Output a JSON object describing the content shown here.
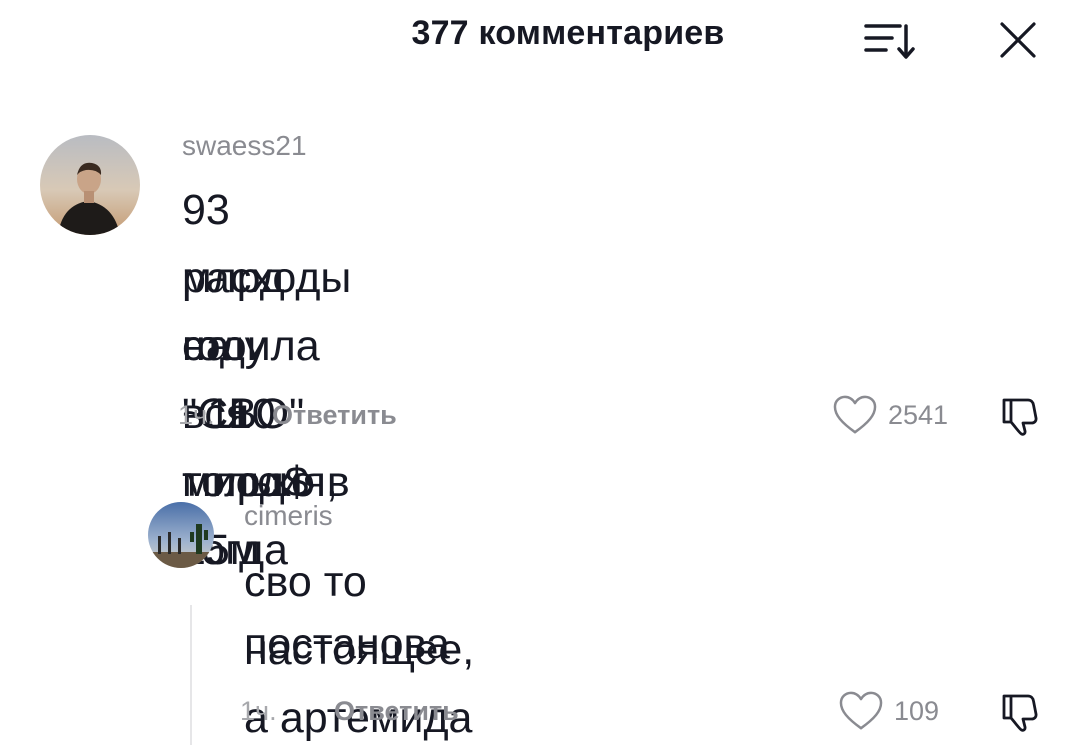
{
  "header": {
    "title": "377 комментариев"
  },
  "comments": [
    {
      "username": "swaess21",
      "text_lines": [
        "93 млрд стоила вся миссия, когда",
        "расходы на \"СВО\" только в 25м",
        "году ~110 млрд$"
      ],
      "time": "1ч.",
      "reply_label": "Ответить",
      "likes": "2541"
    },
    {
      "username": "cimeris",
      "text_lines": [
        "сво то настоящее, а артемида",
        "постанова"
      ],
      "time": "1ч.",
      "reply_label": "Ответить",
      "likes": "109"
    }
  ],
  "icons": {
    "sort": "sort-icon",
    "close": "close-icon",
    "like": "heart-outline-icon",
    "dislike": "thumbs-down-icon"
  },
  "colors": {
    "text": "#161823",
    "secondary": "#8a8b91",
    "muted": "#a7a8ac"
  }
}
